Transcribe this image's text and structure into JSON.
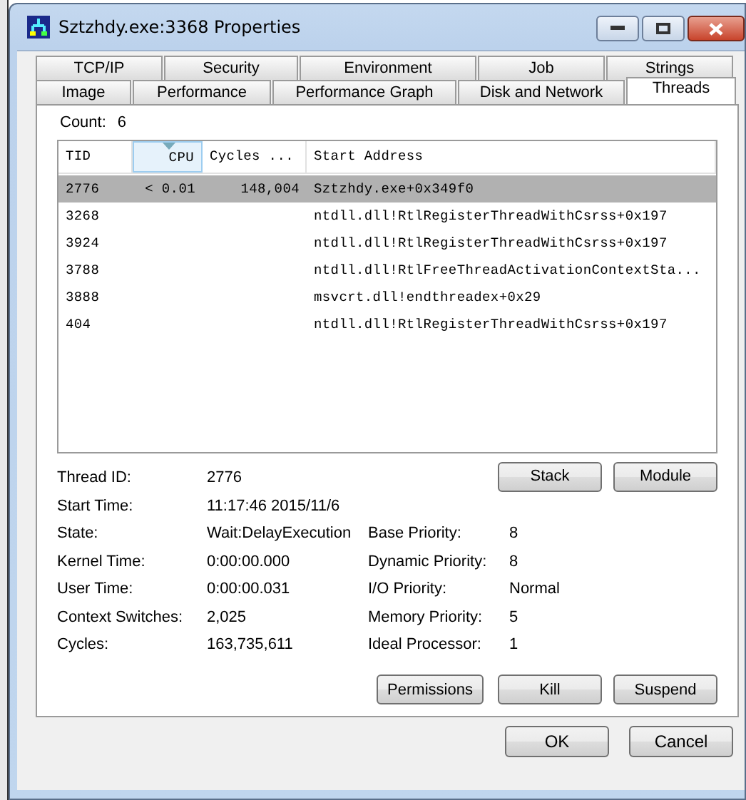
{
  "window": {
    "title": "Sztzhdy.exe:3368 Properties"
  },
  "tab_rows": [
    [
      {
        "label": "TCP/IP",
        "selected": false
      },
      {
        "label": "Security",
        "selected": false
      },
      {
        "label": "Environment",
        "selected": false
      },
      {
        "label": "Job",
        "selected": false
      },
      {
        "label": "Strings",
        "selected": false
      }
    ],
    [
      {
        "label": "Image",
        "selected": false
      },
      {
        "label": "Performance",
        "selected": false
      },
      {
        "label": "Performance Graph",
        "selected": false
      },
      {
        "label": "Disk and Network",
        "selected": false
      },
      {
        "label": "Threads",
        "selected": true
      }
    ]
  ],
  "count": {
    "label": "Count:",
    "value": "6"
  },
  "thread_list": {
    "columns": [
      {
        "label": "TID",
        "sorted": false
      },
      {
        "label": "CPU",
        "sorted": true
      },
      {
        "label": "Cycles ...",
        "sorted": false
      },
      {
        "label": "Start Address",
        "sorted": false
      }
    ],
    "rows": [
      {
        "cells": [
          "2776",
          "< 0.01",
          "148,004",
          "Sztzhdy.exe+0x349f0"
        ],
        "selected": true
      },
      {
        "cells": [
          "3268",
          "",
          "",
          "ntdll.dll!RtlRegisterThreadWithCsrss+0x197"
        ],
        "selected": false
      },
      {
        "cells": [
          "3924",
          "",
          "",
          "ntdll.dll!RtlRegisterThreadWithCsrss+0x197"
        ],
        "selected": false
      },
      {
        "cells": [
          "3788",
          "",
          "",
          "ntdll.dll!RtlFreeThreadActivationContextSta..."
        ],
        "selected": false
      },
      {
        "cells": [
          "3888",
          "",
          "",
          "msvcrt.dll!endthreadex+0x29"
        ],
        "selected": false
      },
      {
        "cells": [
          "404",
          "",
          "",
          "ntdll.dll!RtlRegisterThreadWithCsrss+0x197"
        ],
        "selected": false
      }
    ]
  },
  "thread_info": [
    {
      "label": "Thread ID:",
      "value": "2776"
    },
    {
      "label": "Start Time:",
      "value": "11:17:46   2015/11/6"
    },
    {
      "label": "State:",
      "value": "Wait:DelayExecution"
    },
    {
      "label": "Kernel Time:",
      "value": "0:00:00.000"
    },
    {
      "label": "User Time:",
      "value": "0:00:00.031"
    },
    {
      "label": "Context Switches:",
      "value": "2,025"
    },
    {
      "label": "Cycles:",
      "value": "163,735,611"
    }
  ],
  "priority_info": [
    {
      "label": "Base Priority:",
      "value": "8"
    },
    {
      "label": "Dynamic Priority:",
      "value": "8"
    },
    {
      "label": "I/O Priority:",
      "value": "Normal"
    },
    {
      "label": "Memory Priority:",
      "value": "5"
    },
    {
      "label": "Ideal Processor:",
      "value": "1"
    }
  ],
  "thread_buttons": [
    "Stack",
    "Module"
  ],
  "action_buttons": [
    "Permissions",
    "Kill",
    "Suspend"
  ],
  "dialog_buttons": [
    "OK",
    "Cancel"
  ]
}
